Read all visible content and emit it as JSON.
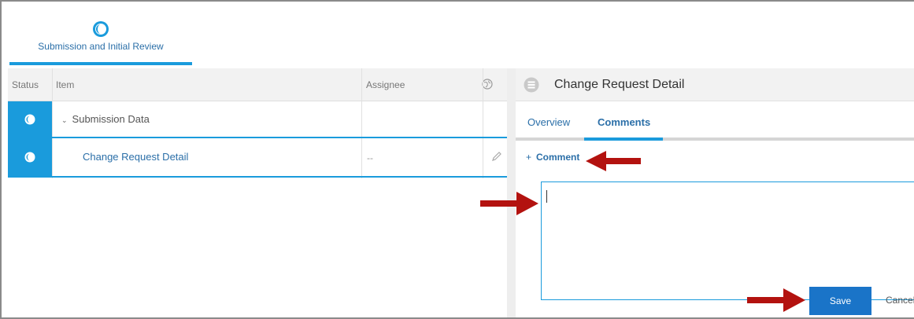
{
  "stage": {
    "label": "Submission and Initial Review",
    "icon": "half-moon-status-icon"
  },
  "grid": {
    "headers": {
      "status": "Status",
      "item": "Item",
      "assignee": "Assignee",
      "globe_icon": "globe-icon"
    },
    "rows": [
      {
        "item": "Submission Data",
        "expand_icon": "chevron-down-icon",
        "assignee": ""
      },
      {
        "item": "Change Request Detail",
        "assignee": "--",
        "edit_icon": "pencil-icon"
      }
    ]
  },
  "detail": {
    "title": "Change Request Detail",
    "icon": "list-icon",
    "tabs": [
      {
        "label": "Overview"
      },
      {
        "label": "Comments",
        "active": true
      }
    ],
    "add_comment": {
      "plus": "+",
      "label": "Comment"
    },
    "comment_value": "",
    "save_label": "Save",
    "cancel_label": "Cancel"
  },
  "colors": {
    "accent": "#1a9bdc",
    "button": "#1a74c8",
    "annotation_arrow": "#b3120f"
  }
}
